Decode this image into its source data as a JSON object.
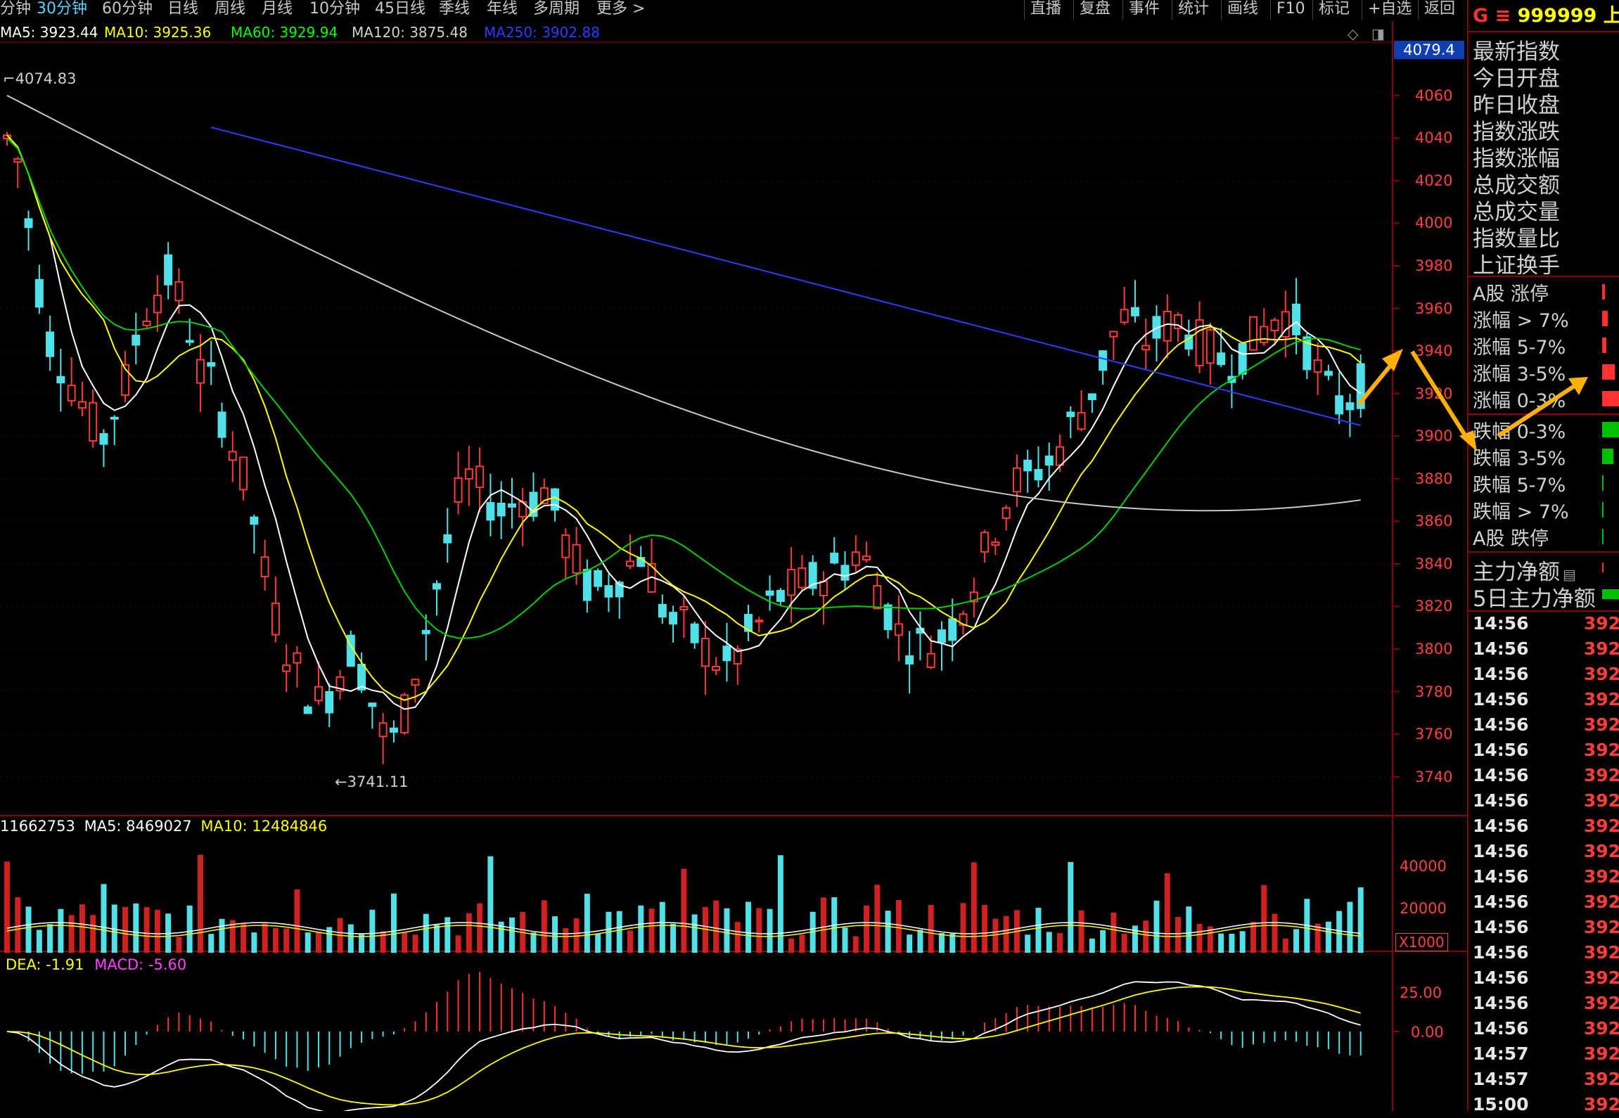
{
  "toolbar": {
    "periods": [
      "分钟",
      "30分钟",
      "60分钟",
      "日线",
      "周线",
      "月线",
      "10分钟",
      "45日线",
      "季线",
      "年线",
      "多周期",
      "更多 >"
    ],
    "active_index": 1,
    "buttons": [
      "直播",
      "复盘",
      "事件",
      "统计",
      "画线",
      "F10",
      "标记",
      "+自选",
      "返回"
    ]
  },
  "ma_legend": {
    "ma5": "MA5: 3923.44",
    "ma10": "MA10: 3925.36",
    "ma60": "MA60: 3929.94",
    "ma120": "MA120: 3875.48",
    "ma250": "MA250: 3902.88",
    "colors": {
      "ma5": "#ffffff",
      "ma10": "#ffff00",
      "ma60": "#00ff00",
      "ma120": "#d0d0d0",
      "ma250": "#2f3cff"
    }
  },
  "price_axis": {
    "current_price_tag": "4079.4",
    "ticks": [
      "4060",
      "4040",
      "4020",
      "4000",
      "3980",
      "3960",
      "3940",
      "3920",
      "3900",
      "3880",
      "3860",
      "3840",
      "3820",
      "3800",
      "3780",
      "3760",
      "3740"
    ],
    "high_label": "4074.83",
    "low_label": "3741.11"
  },
  "volume": {
    "legend_total": "11662753",
    "legend_ma5": "MA5: 8469027",
    "legend_ma10": "MA10: 12484846",
    "ticks": [
      "40000",
      "20000"
    ],
    "unit": "X1000"
  },
  "macd": {
    "dea": "DEA: -1.91",
    "macd": "MACD: -5.60",
    "ticks": [
      "25.00",
      "0.00"
    ]
  },
  "right_panel": {
    "header_code": "999999",
    "header_name": "上证",
    "header_prefix": "G ≡",
    "quote_labels": [
      "最新指数",
      "今日开盘",
      "昨日收盘",
      "指数涨跌",
      "指数涨幅",
      "总成交额",
      "总成交量",
      "指数量比",
      "上证换手"
    ],
    "breadth_up": [
      "A股 涨停",
      "涨幅 > 7%",
      "涨幅 5-7%",
      "涨幅 3-5%",
      "涨幅 0-3%"
    ],
    "breadth_down": [
      "跌幅 0-3%",
      "跌幅 3-5%",
      "跌幅 5-7%",
      "跌幅 > 7%",
      "A股 跌停"
    ],
    "flow_labels": [
      "主力净额",
      "5日主力净额"
    ],
    "ticks": [
      {
        "time": "14:56",
        "value": "392"
      },
      {
        "time": "14:56",
        "value": "392"
      },
      {
        "time": "14:56",
        "value": "392"
      },
      {
        "time": "14:56",
        "value": "392"
      },
      {
        "time": "14:56",
        "value": "392"
      },
      {
        "time": "14:56",
        "value": "392"
      },
      {
        "time": "14:56",
        "value": "392"
      },
      {
        "time": "14:56",
        "value": "392"
      },
      {
        "time": "14:56",
        "value": "392"
      },
      {
        "time": "14:56",
        "value": "392"
      },
      {
        "time": "14:56",
        "value": "392"
      },
      {
        "time": "14:56",
        "value": "392"
      },
      {
        "time": "14:56",
        "value": "392"
      },
      {
        "time": "14:56",
        "value": "392"
      },
      {
        "time": "14:56",
        "value": "392"
      },
      {
        "time": "14:56",
        "value": "392"
      },
      {
        "time": "14:56",
        "value": "392"
      },
      {
        "time": "14:57",
        "value": "392"
      },
      {
        "time": "14:57",
        "value": "392"
      },
      {
        "time": "15:00",
        "value": "392"
      }
    ]
  },
  "chart_data": {
    "type": "candlestick",
    "title": "",
    "ylim": [
      3730,
      4085
    ],
    "y_ticks": [
      4060,
      4040,
      4020,
      4000,
      3980,
      3960,
      3940,
      3920,
      3900,
      3880,
      3860,
      3840,
      3820,
      3800,
      3780,
      3760,
      3740
    ],
    "high": 4074.83,
    "low": 3741.11,
    "trend_close": [
      4040,
      4030,
      4000,
      3970,
      3945,
      3935,
      3925,
      3915,
      3905,
      3900,
      3912,
      3925,
      3945,
      3960,
      3968,
      3975,
      3965,
      3950,
      3930,
      3925,
      3910,
      3895,
      3880,
      3860,
      3835,
      3815,
      3800,
      3790,
      3780,
      3775,
      3780,
      3790,
      3800,
      3790,
      3775,
      3760,
      3758,
      3770,
      3790,
      3810,
      3830,
      3850,
      3870,
      3880,
      3875,
      3870,
      3865,
      3868,
      3872,
      3870,
      3875,
      3865,
      3850,
      3840,
      3830,
      3828,
      3830,
      3835,
      3840,
      3845,
      3835,
      3820,
      3812,
      3810,
      3805,
      3800,
      3795,
      3792,
      3798,
      3806,
      3812,
      3820,
      3825,
      3828,
      3830,
      3832,
      3835,
      3838,
      3840,
      3845,
      3840,
      3830,
      3818,
      3808,
      3804,
      3802,
      3802,
      3806,
      3812,
      3822,
      3832,
      3845,
      3858,
      3870,
      3878,
      3880,
      3885,
      3888,
      3895,
      3905,
      3912,
      3922,
      3935,
      3948,
      3955,
      3950,
      3945,
      3948,
      3952,
      3954,
      3950,
      3944,
      3940,
      3936,
      3936,
      3940,
      3945,
      3950,
      3955,
      3957,
      3952,
      3942,
      3930,
      3920,
      3915,
      3918,
      3924
    ],
    "ma5": "white",
    "ma10": "yellow",
    "ma60": "green",
    "ma120": "grey",
    "ma250": "blue",
    "volume_ticks": [
      40000,
      20000
    ],
    "macd_ticks": [
      25.0,
      0.0
    ]
  }
}
